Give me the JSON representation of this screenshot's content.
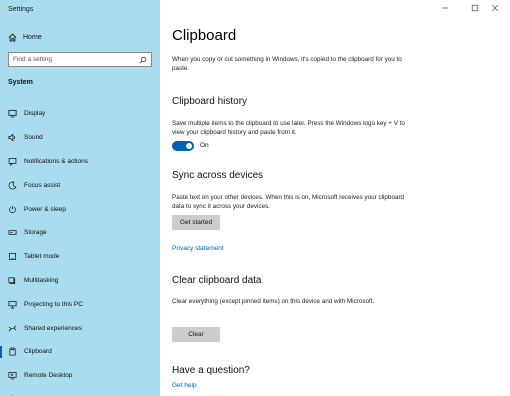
{
  "window": {
    "title": "Settings"
  },
  "sidebar": {
    "home_label": "Home",
    "search": {
      "placeholder": "Find a setting"
    },
    "section_label": "System",
    "items": [
      {
        "label": "Display",
        "icon": "display-icon"
      },
      {
        "label": "Sound",
        "icon": "speaker-icon"
      },
      {
        "label": "Notifications & actions",
        "icon": "notifications-icon"
      },
      {
        "label": "Focus assist",
        "icon": "moon-icon"
      },
      {
        "label": "Power & sleep",
        "icon": "power-icon"
      },
      {
        "label": "Storage",
        "icon": "storage-icon"
      },
      {
        "label": "Tablet mode",
        "icon": "tablet-icon"
      },
      {
        "label": "Multitasking",
        "icon": "multitasking-icon"
      },
      {
        "label": "Projecting to this PC",
        "icon": "projecting-icon"
      },
      {
        "label": "Shared experiences",
        "icon": "shared-experiences-icon"
      },
      {
        "label": "Clipboard",
        "icon": "clipboard-icon",
        "selected": true
      },
      {
        "label": "Remote Desktop",
        "icon": "remote-desktop-icon"
      }
    ]
  },
  "main": {
    "title": "Clipboard",
    "intro": "When you copy or cut something in Windows, it's copied to the clipboard for you to paste.",
    "history": {
      "heading": "Clipboard history",
      "description": "Save multiple items to the clipboard to use later. Press the Windows logo key + V to view your clipboard history and paste from it.",
      "toggle_state": "On",
      "toggle_on": true
    },
    "sync": {
      "heading": "Sync across devices",
      "description": "Paste text on your other devices. When this is on, Microsoft receives your clipboard data to sync it across your devices.",
      "button_label": "Get started",
      "link_label": "Privacy statement"
    },
    "clear": {
      "heading": "Clear clipboard data",
      "description": "Clear everything (except pinned items) on this device and with Microsoft.",
      "button_label": "Clear"
    },
    "question": {
      "heading": "Have a question?",
      "link_label": "Get help"
    }
  },
  "colors": {
    "sidebar_bg": "#a9dcee",
    "accent": "#0063b1",
    "button_bg": "#cccccc"
  }
}
